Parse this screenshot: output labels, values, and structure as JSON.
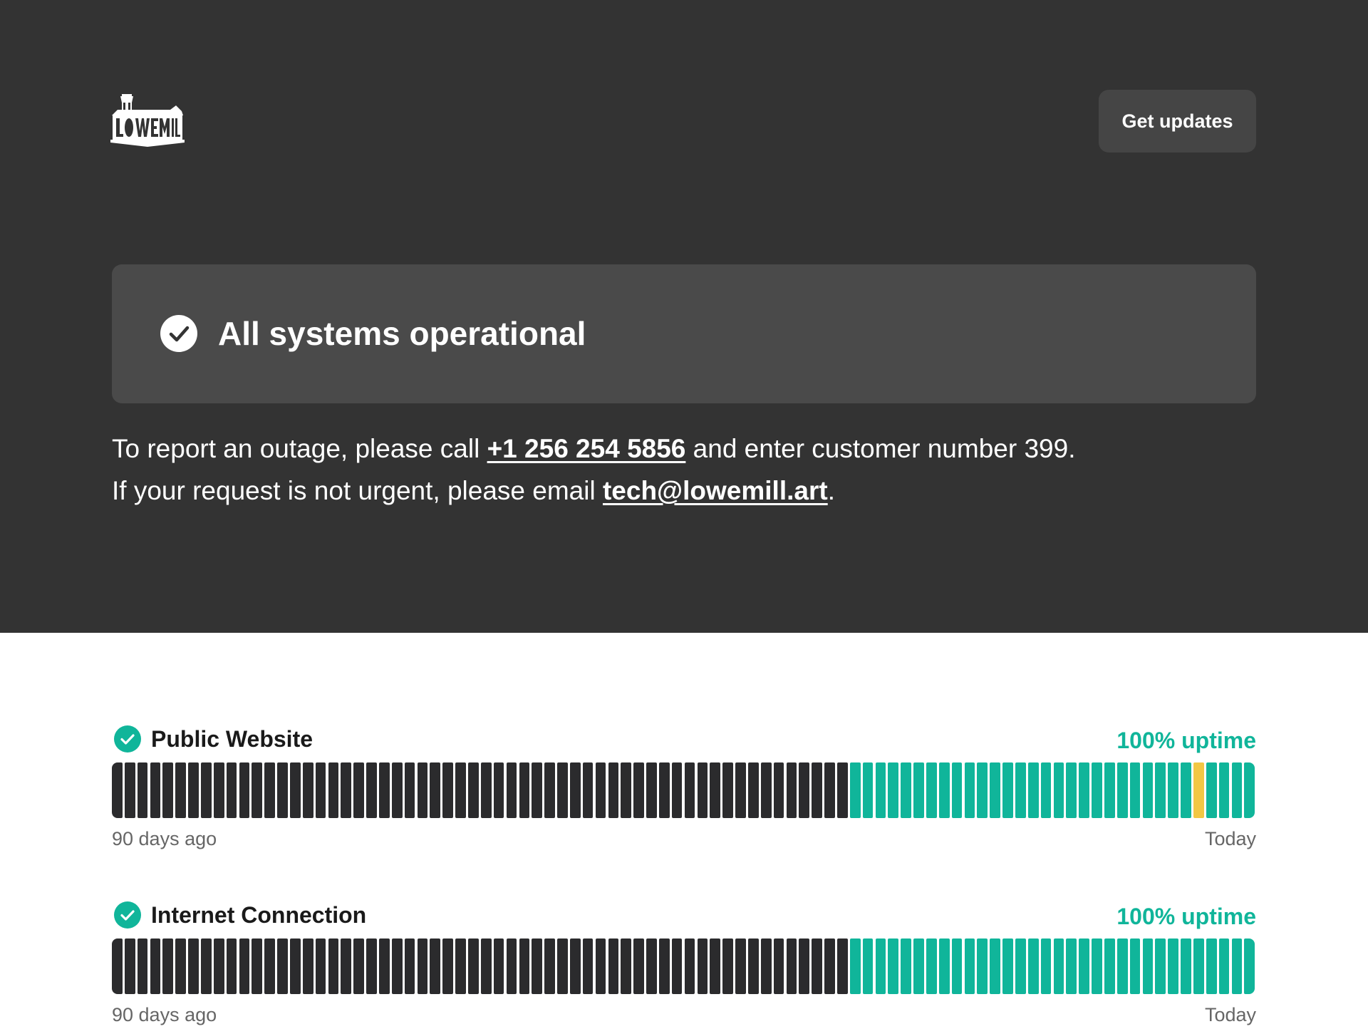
{
  "brand": {
    "logo_text": "LOWE MILL",
    "logo_icon": "water-tower-building-logo"
  },
  "header": {
    "get_updates_label": "Get updates"
  },
  "status": {
    "icon": "check-circle-icon",
    "text": "All systems operational"
  },
  "notice": {
    "line1_prefix": "To report an outage, please call ",
    "phone": "+1 256 254 5856",
    "line1_suffix": " and enter customer number 399.",
    "line2_prefix": "If your request is not urgent, please email ",
    "email": "tech@lowemill.art",
    "line2_suffix": "."
  },
  "colors": {
    "up": "#10b59a",
    "no_data": "#2b2b2d",
    "degraded": "#f2c744"
  },
  "components": [
    {
      "name": "Public Website",
      "uptime": "100% uptime",
      "range_start": "90 days ago",
      "range_end": "Today",
      "days_total": 90,
      "days_no_data": 58,
      "degraded_day_indices": [
        85
      ]
    },
    {
      "name": "Internet Connection",
      "uptime": "100% uptime",
      "range_start": "90 days ago",
      "range_end": "Today",
      "days_total": 90,
      "days_no_data": 58,
      "degraded_day_indices": []
    }
  ]
}
